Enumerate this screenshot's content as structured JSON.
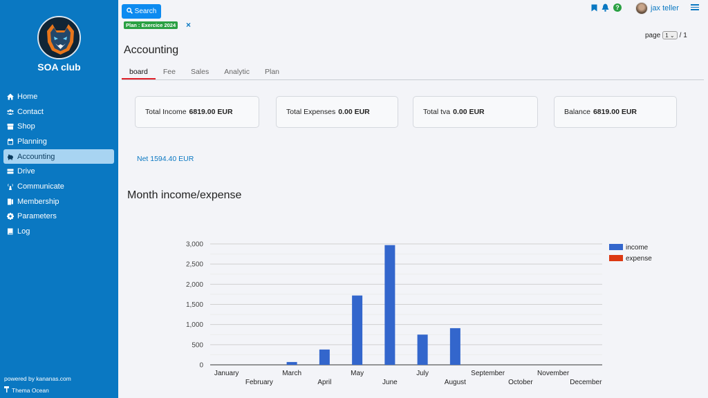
{
  "app": {
    "club_name": "SOA club",
    "powered_by": "powered by kananas.com",
    "theme": "Thema Ocean"
  },
  "sidebar": {
    "items": [
      {
        "label": "Home",
        "icon": "home-icon"
      },
      {
        "label": "Contact",
        "icon": "users-icon"
      },
      {
        "label": "Shop",
        "icon": "shop-icon"
      },
      {
        "label": "Planning",
        "icon": "calendar-icon"
      },
      {
        "label": "Accounting",
        "icon": "piggy-bank-icon",
        "active": true
      },
      {
        "label": "Drive",
        "icon": "drive-icon"
      },
      {
        "label": "Communicate",
        "icon": "broadcast-icon"
      },
      {
        "label": "Membership",
        "icon": "id-card-icon"
      },
      {
        "label": "Parameters",
        "icon": "gear-icon"
      },
      {
        "label": "Log",
        "icon": "book-icon"
      }
    ]
  },
  "header": {
    "search_label": "Search",
    "plan_badge": "Plan : Exercice 2024",
    "plan_close": "×",
    "user_name": "jax teller",
    "page_label": "page",
    "page_value": "1",
    "page_total": "/ 1"
  },
  "main": {
    "title": "Accounting",
    "tabs": [
      {
        "label": "board",
        "active": true
      },
      {
        "label": "Fee"
      },
      {
        "label": "Sales"
      },
      {
        "label": "Analytic"
      },
      {
        "label": "Plan"
      }
    ],
    "cards": [
      {
        "label": "Total Income",
        "value": "6819.00 EUR"
      },
      {
        "label": "Total Expenses",
        "value": "0.00 EUR"
      },
      {
        "label": "Total tva",
        "value": "0.00 EUR"
      },
      {
        "label": "Balance",
        "value": "6819.00 EUR"
      }
    ],
    "net": "Net 1594.40 EUR",
    "chart_title": "Month income/expense"
  },
  "colors": {
    "sidebar": "#0a78c2",
    "income": "#3366cc",
    "expense": "#dc3912",
    "badge": "#2aa043",
    "active_tab": "#e0202a"
  },
  "chart_data": {
    "type": "bar",
    "categories": [
      "January",
      "February",
      "March",
      "April",
      "May",
      "June",
      "July",
      "August",
      "September",
      "October",
      "November",
      "December"
    ],
    "series": [
      {
        "name": "income",
        "values": [
          0,
          0,
          70,
          380,
          1720,
          2970,
          750,
          910,
          0,
          0,
          0,
          0
        ]
      },
      {
        "name": "expense",
        "values": [
          0,
          0,
          0,
          0,
          0,
          0,
          0,
          0,
          0,
          0,
          0,
          0
        ]
      }
    ],
    "yticks": [
      "0",
      "500",
      "1,000",
      "1,500",
      "2,000",
      "2,500",
      "3,000"
    ],
    "ylim": [
      0,
      3000
    ],
    "grid": true,
    "legend": "right"
  }
}
